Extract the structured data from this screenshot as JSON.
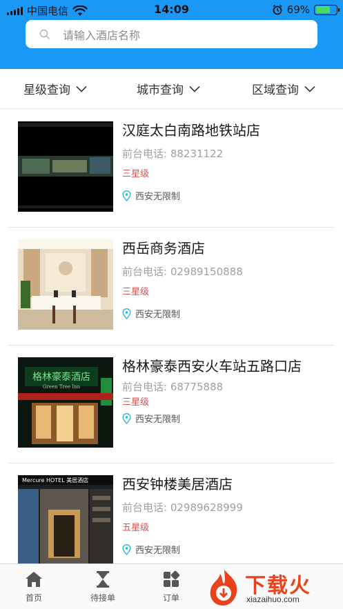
{
  "status_bar": {
    "carrier": "中国电信",
    "time": "14:09",
    "battery": "69%",
    "battery_level": 0.69
  },
  "search": {
    "placeholder": "请输入酒店名称"
  },
  "filters": [
    {
      "label": "星级查询"
    },
    {
      "label": "城市查询"
    },
    {
      "label": "区域查询"
    }
  ],
  "hotels": [
    {
      "name": "汉庭太白南路地铁站店",
      "phone": "前台电话:  88231122",
      "stars": "三星级",
      "location": "西安无限制",
      "image": "dark-screen-photo"
    },
    {
      "name": "西岳商务酒店",
      "phone": "前台电话:  02989150888",
      "stars": "三星级",
      "location": "西安无限制",
      "image": "hotel-lobby-photo"
    },
    {
      "name": "格林豪泰西安火车站五路口店",
      "phone": "前台电话:  68775888",
      "stars": "三星级",
      "location": "西安无限制",
      "image": "green-tree-inn-facade-photo",
      "sign": "格林豪泰酒店",
      "sign_en": "Green Tree Inn"
    },
    {
      "name": "西安钟楼美居酒店",
      "phone": "前台电话:  02989628999",
      "stars": "五星级",
      "location": "西安无限制",
      "image": "mercure-hotel-facade-photo",
      "sign": "Mercure HOTEL 美居酒店"
    }
  ],
  "tabs": [
    {
      "label": "首页",
      "icon": "home-icon"
    },
    {
      "label": "待接单",
      "icon": "hourglass-icon"
    },
    {
      "label": "订单",
      "icon": "grid-icon"
    }
  ],
  "watermark": {
    "text": "下载火",
    "url": "xiazaihuo.com"
  },
  "colors": {
    "header_blue": "#1a98f5",
    "star_red": "#d9534f",
    "pin_cyan": "#2bb5d8",
    "watermark_orange": "#e8431d"
  }
}
